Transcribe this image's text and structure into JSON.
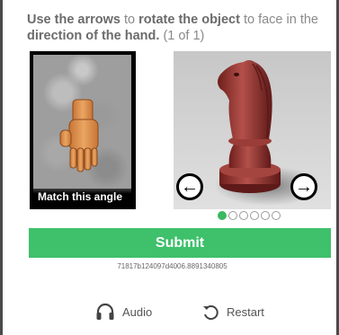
{
  "instruction": {
    "part1": "Use the arrows",
    "part2": " to ",
    "part3": "rotate the object",
    "part4": " to face in the ",
    "part5": "direction of the hand.",
    "part6": " (1 of 1)"
  },
  "reference": {
    "caption": "Match this angle",
    "hand_color": "#e3964f"
  },
  "object": {
    "name": "chess-knight",
    "color": "#9c3431"
  },
  "navigation": {
    "left_icon": "arrow-left-icon",
    "right_icon": "arrow-right-icon",
    "left_glyph": "←",
    "right_glyph": "→"
  },
  "pagination": {
    "total": 6,
    "active_index": 0,
    "active_color": "#3cb95f"
  },
  "submit": {
    "label": "Submit",
    "color": "#3fc06b"
  },
  "session_id": "71817b124097d4006.8891340805",
  "footer": {
    "audio_label": "Audio",
    "restart_label": "Restart"
  }
}
